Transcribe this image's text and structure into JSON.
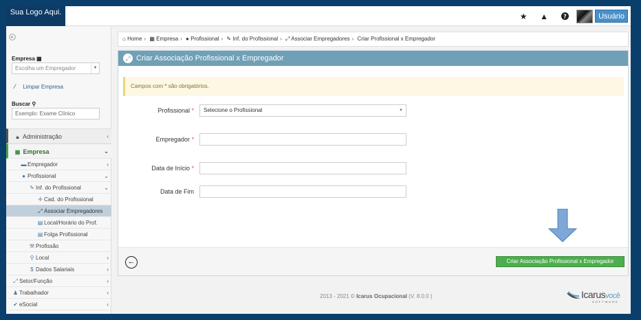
{
  "header": {
    "logo": "Sua Logo Aqui.",
    "user_label": "Usuário",
    "icons": [
      "star-icon",
      "warning-icon",
      "question-icon"
    ]
  },
  "sidebar": {
    "empresa_label": "Empresa",
    "empresa_placeholder": "Escolha um Empregador",
    "clear_label": "Limpar Empresa",
    "buscar_label": "Buscar",
    "buscar_placeholder": "Exemplo: Exame Clínico",
    "menu": [
      {
        "label": "Administração",
        "level": 0
      },
      {
        "label": "Empresa",
        "level": 0,
        "active": true
      },
      {
        "label": "Empregador",
        "level": 1
      },
      {
        "label": "Profissional",
        "level": 1
      },
      {
        "label": "Inf. do Profissional",
        "level": 2
      },
      {
        "label": "Cad. do Profissional",
        "level": 3
      },
      {
        "label": "Associar Empregadores",
        "level": 3,
        "selected": true
      },
      {
        "label": "Local/Horário do Prof.",
        "level": 3
      },
      {
        "label": "Folga Profissional",
        "level": 3
      },
      {
        "label": "Profissão",
        "level": 2
      },
      {
        "label": "Local",
        "level": 2
      },
      {
        "label": "Dados Salariais",
        "level": 2
      },
      {
        "label": "Setor/Função",
        "level": 1
      },
      {
        "label": "Trabalhador",
        "level": 1
      },
      {
        "label": "eSocial",
        "level": 1
      }
    ]
  },
  "breadcrumb": [
    "Home",
    "Empresa",
    "Profissional",
    "Inf. do Profissional",
    "Associar Empregadores",
    "Criar Profissional x Empregador"
  ],
  "panel": {
    "title": "Criar Associação Profissional x Empregador",
    "alert_pre": "Campos com",
    "alert_star": "*",
    "alert_post": "são obrigatórios.",
    "fields": {
      "profissional_label": "Profissional",
      "profissional_value": "Selecione o Profissional",
      "empregador_label": "Empregador",
      "inicio_label": "Data de Início",
      "fim_label": "Data de Fim",
      "required_mark": "*"
    },
    "submit_label": "Criar Associação Profissional x Empregador"
  },
  "footer": {
    "years": "2013 - 2021 ©",
    "product": "Icarus Ocupacional",
    "version": "(V. 8.0.0 )",
    "brand_main": "Icarus",
    "brand_accent": "você",
    "brand_sub": "SOFTWARE"
  },
  "colors": {
    "panel_header": "#6fa0b5",
    "submit": "#4cae4c",
    "user_button": "#4a90c8",
    "arrow": "#7ea7d8"
  }
}
